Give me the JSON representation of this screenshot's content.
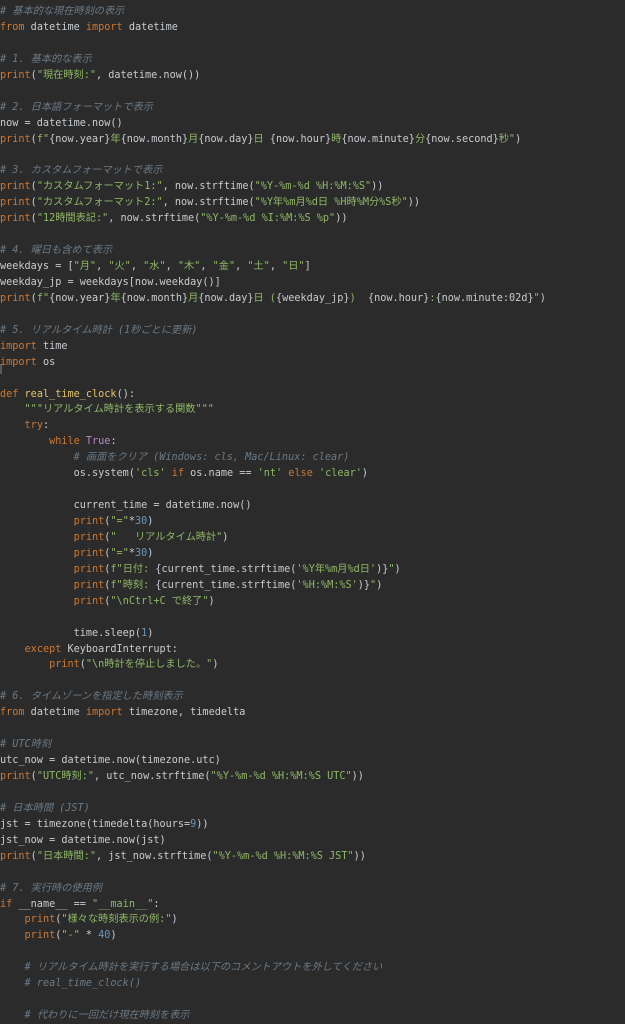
{
  "theme": {
    "background": "#2b2b2b",
    "default_text": "#c8ccd0",
    "keyword": "#cc7832",
    "string": "#8fb866",
    "comment": "#6b7a86",
    "function": "#e0c36a",
    "number": "#6897bb",
    "builtin": "#b78bc7"
  },
  "editor": {
    "lines": [
      [
        [
          "com",
          "# 基本的な現在時刻の表示"
        ]
      ],
      [
        [
          "kw",
          "from"
        ],
        [
          "id",
          " datetime "
        ],
        [
          "kw",
          "import"
        ],
        [
          "id",
          " datetime"
        ]
      ],
      [],
      [
        [
          "com",
          "# 1. 基本的な表示"
        ]
      ],
      [
        [
          "kw",
          "print"
        ],
        [
          "id",
          "("
        ],
        [
          "str",
          "\"現在時刻:\""
        ],
        [
          "id",
          ", datetime.now())"
        ]
      ],
      [],
      [
        [
          "com",
          "# 2. 日本語フォーマットで表示"
        ]
      ],
      [
        [
          "id",
          "now = datetime.now()"
        ]
      ],
      [
        [
          "kw",
          "print"
        ],
        [
          "id",
          "("
        ],
        [
          "str",
          "f\""
        ],
        [
          "id",
          "{now.year}"
        ],
        [
          "str",
          "年"
        ],
        [
          "id",
          "{now.month}"
        ],
        [
          "str",
          "月"
        ],
        [
          "id",
          "{now.day}"
        ],
        [
          "str",
          "日 "
        ],
        [
          "id",
          "{now.hour}"
        ],
        [
          "str",
          "時"
        ],
        [
          "id",
          "{now.minute}"
        ],
        [
          "str",
          "分"
        ],
        [
          "id",
          "{now.second}"
        ],
        [
          "str",
          "秒\""
        ],
        [
          "id",
          ")"
        ]
      ],
      [],
      [
        [
          "com",
          "# 3. カスタムフォーマットで表示"
        ]
      ],
      [
        [
          "kw",
          "print"
        ],
        [
          "id",
          "("
        ],
        [
          "str",
          "\"カスタムフォーマット1:\""
        ],
        [
          "id",
          ", now.strftime("
        ],
        [
          "str",
          "\"%Y-%m-%d %H:%M:%S\""
        ],
        [
          "id",
          "))"
        ]
      ],
      [
        [
          "kw",
          "print"
        ],
        [
          "id",
          "("
        ],
        [
          "str",
          "\"カスタムフォーマット2:\""
        ],
        [
          "id",
          ", now.strftime("
        ],
        [
          "str",
          "\"%Y年%m月%d日 %H時%M分%S秒\""
        ],
        [
          "id",
          "))"
        ]
      ],
      [
        [
          "kw",
          "print"
        ],
        [
          "id",
          "("
        ],
        [
          "str",
          "\"12時間表記:\""
        ],
        [
          "id",
          ", now.strftime("
        ],
        [
          "str",
          "\"%Y-%m-%d %I:%M:%S %p\""
        ],
        [
          "id",
          "))"
        ]
      ],
      [],
      [
        [
          "com",
          "# 4. 曜日も含めて表示"
        ]
      ],
      [
        [
          "id",
          "weekdays = ["
        ],
        [
          "str",
          "\"月\""
        ],
        [
          "id",
          ", "
        ],
        [
          "str",
          "\"火\""
        ],
        [
          "id",
          ", "
        ],
        [
          "str",
          "\"水\""
        ],
        [
          "id",
          ", "
        ],
        [
          "str",
          "\"木\""
        ],
        [
          "id",
          ", "
        ],
        [
          "str",
          "\"金\""
        ],
        [
          "id",
          ", "
        ],
        [
          "str",
          "\"土\""
        ],
        [
          "id",
          ", "
        ],
        [
          "str",
          "\"日\""
        ],
        [
          "id",
          "]"
        ]
      ],
      [
        [
          "id",
          "weekday_jp = weekdays[now.weekday()]"
        ]
      ],
      [
        [
          "kw",
          "print"
        ],
        [
          "id",
          "("
        ],
        [
          "str",
          "f\""
        ],
        [
          "id",
          "{now.year}"
        ],
        [
          "str",
          "年"
        ],
        [
          "id",
          "{now.month}"
        ],
        [
          "str",
          "月"
        ],
        [
          "id",
          "{now.day}"
        ],
        [
          "str",
          "日 ("
        ],
        [
          "id",
          "{weekday_jp}"
        ],
        [
          "str",
          ")  "
        ],
        [
          "id",
          "{now.hour}"
        ],
        [
          "str",
          ":"
        ],
        [
          "id",
          "{now.minute:02d}"
        ],
        [
          "str",
          "\""
        ],
        [
          "id",
          ")"
        ]
      ],
      [],
      [
        [
          "com",
          "# 5. リアルタイム時計 (1秒ごとに更新)"
        ]
      ],
      [
        [
          "kw",
          "import"
        ],
        [
          "id",
          " time"
        ]
      ],
      [
        [
          "kw",
          "import"
        ],
        [
          "id",
          " os"
        ]
      ],
      [],
      [
        [
          "kw",
          "def "
        ],
        [
          "fn",
          "real_time_clock"
        ],
        [
          "id",
          "():"
        ]
      ],
      [
        [
          "id",
          "    "
        ],
        [
          "str",
          "\"\"\"リアルタイム時計を表示する関数\"\"\""
        ]
      ],
      [
        [
          "id",
          "    "
        ],
        [
          "kw",
          "try"
        ],
        [
          "id",
          ":"
        ]
      ],
      [
        [
          "id",
          "        "
        ],
        [
          "kw",
          "while "
        ],
        [
          "bi",
          "True"
        ],
        [
          "id",
          ":"
        ]
      ],
      [
        [
          "id",
          "            "
        ],
        [
          "com",
          "# 画面をクリア (Windows: cls, Mac/Linux: clear)"
        ]
      ],
      [
        [
          "id",
          "            os.system("
        ],
        [
          "str",
          "'cls'"
        ],
        [
          "kw",
          " if "
        ],
        [
          "id",
          "os.name == "
        ],
        [
          "str",
          "'nt'"
        ],
        [
          "kw",
          " else "
        ],
        [
          "str",
          "'clear'"
        ],
        [
          "id",
          ")"
        ]
      ],
      [],
      [
        [
          "id",
          "            current_time = datetime.now()"
        ]
      ],
      [
        [
          "id",
          "            "
        ],
        [
          "kw",
          "print"
        ],
        [
          "id",
          "("
        ],
        [
          "str",
          "\"=\""
        ],
        [
          "id",
          "*"
        ],
        [
          "num",
          "30"
        ],
        [
          "id",
          ")"
        ]
      ],
      [
        [
          "id",
          "            "
        ],
        [
          "kw",
          "print"
        ],
        [
          "id",
          "("
        ],
        [
          "str",
          "\"   リアルタイム時計\""
        ],
        [
          "id",
          ")"
        ]
      ],
      [
        [
          "id",
          "            "
        ],
        [
          "kw",
          "print"
        ],
        [
          "id",
          "("
        ],
        [
          "str",
          "\"=\""
        ],
        [
          "id",
          "*"
        ],
        [
          "num",
          "30"
        ],
        [
          "id",
          ")"
        ]
      ],
      [
        [
          "id",
          "            "
        ],
        [
          "kw",
          "print"
        ],
        [
          "id",
          "("
        ],
        [
          "str",
          "f\"日付: "
        ],
        [
          "id",
          "{current_time.strftime("
        ],
        [
          "str",
          "'%Y年%m月%d日'"
        ],
        [
          "id",
          ")}"
        ],
        [
          "str",
          "\""
        ],
        [
          "id",
          ")"
        ]
      ],
      [
        [
          "id",
          "            "
        ],
        [
          "kw",
          "print"
        ],
        [
          "id",
          "("
        ],
        [
          "str",
          "f\"時刻: "
        ],
        [
          "id",
          "{current_time.strftime("
        ],
        [
          "str",
          "'%H:%M:%S'"
        ],
        [
          "id",
          ")}"
        ],
        [
          "str",
          "\""
        ],
        [
          "id",
          ")"
        ]
      ],
      [
        [
          "id",
          "            "
        ],
        [
          "kw",
          "print"
        ],
        [
          "id",
          "("
        ],
        [
          "str",
          "\"\\nCtrl+C で終了\""
        ],
        [
          "id",
          ")"
        ]
      ],
      [],
      [
        [
          "id",
          "            time.sleep("
        ],
        [
          "num",
          "1"
        ],
        [
          "id",
          ")"
        ]
      ],
      [
        [
          "id",
          "    "
        ],
        [
          "kw",
          "except "
        ],
        [
          "id",
          "KeyboardInterrupt:"
        ]
      ],
      [
        [
          "id",
          "        "
        ],
        [
          "kw",
          "print"
        ],
        [
          "id",
          "("
        ],
        [
          "str",
          "\"\\n時計を停止しました。\""
        ],
        [
          "id",
          ")"
        ]
      ],
      [],
      [
        [
          "com",
          "# 6. タイムゾーンを指定した時刻表示"
        ]
      ],
      [
        [
          "kw",
          "from"
        ],
        [
          "id",
          " datetime "
        ],
        [
          "kw",
          "import"
        ],
        [
          "id",
          " timezone, timedelta"
        ]
      ],
      [],
      [
        [
          "com",
          "# UTC時刻"
        ]
      ],
      [
        [
          "id",
          "utc_now = datetime.now(timezone.utc)"
        ]
      ],
      [
        [
          "kw",
          "print"
        ],
        [
          "id",
          "("
        ],
        [
          "str",
          "\"UTC時刻:\""
        ],
        [
          "id",
          ", utc_now.strftime("
        ],
        [
          "str",
          "\"%Y-%m-%d %H:%M:%S UTC\""
        ],
        [
          "id",
          "))"
        ]
      ],
      [],
      [
        [
          "com",
          "# 日本時間 (JST)"
        ]
      ],
      [
        [
          "id",
          "jst = timezone(timedelta(hours="
        ],
        [
          "num",
          "9"
        ],
        [
          "id",
          "))"
        ]
      ],
      [
        [
          "id",
          "jst_now = datetime.now(jst)"
        ]
      ],
      [
        [
          "kw",
          "print"
        ],
        [
          "id",
          "("
        ],
        [
          "str",
          "\"日本時間:\""
        ],
        [
          "id",
          ", jst_now.strftime("
        ],
        [
          "str",
          "\"%Y-%m-%d %H:%M:%S JST\""
        ],
        [
          "id",
          "))"
        ]
      ],
      [],
      [
        [
          "com",
          "# 7. 実行時の使用例"
        ]
      ],
      [
        [
          "kw",
          "if "
        ],
        [
          "id",
          "__name__ == "
        ],
        [
          "str",
          "\"__main__\""
        ],
        [
          "id",
          ":"
        ]
      ],
      [
        [
          "id",
          "    "
        ],
        [
          "kw",
          "print"
        ],
        [
          "id",
          "("
        ],
        [
          "str",
          "\"様々な時刻表示の例:\""
        ],
        [
          "id",
          ")"
        ]
      ],
      [
        [
          "id",
          "    "
        ],
        [
          "kw",
          "print"
        ],
        [
          "id",
          "("
        ],
        [
          "str",
          "\"-\""
        ],
        [
          "id",
          " * "
        ],
        [
          "num",
          "40"
        ],
        [
          "id",
          ")"
        ]
      ],
      [],
      [
        [
          "id",
          "    "
        ],
        [
          "com",
          "# リアルタイム時計を実行する場合は以下のコメントアウトを外してください"
        ]
      ],
      [
        [
          "id",
          "    "
        ],
        [
          "com",
          "# real_time_clock()"
        ]
      ],
      [],
      [
        [
          "id",
          "    "
        ],
        [
          "com",
          "# 代わりに一回だけ現在時刻を表示"
        ]
      ]
    ]
  }
}
